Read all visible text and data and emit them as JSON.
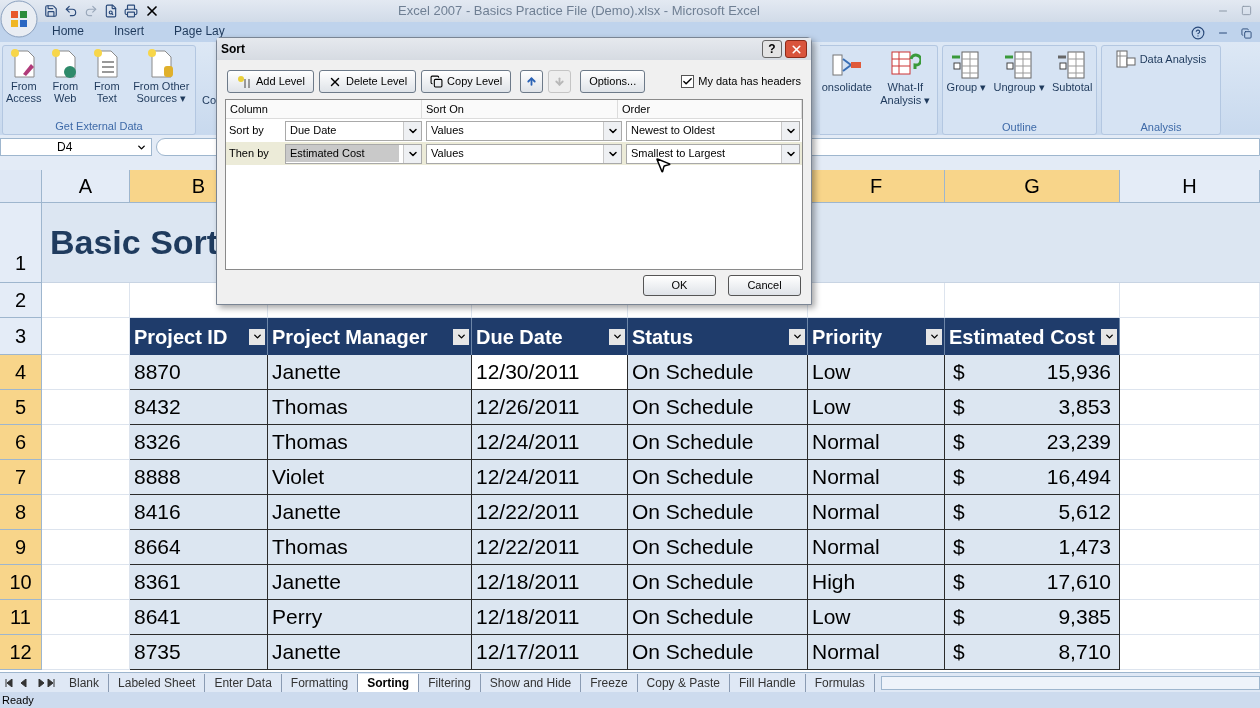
{
  "title_bar": {
    "title": "Excel 2007 - Basics Practice File (Demo).xlsx - Microsoft Excel"
  },
  "ribbon_tabs": [
    {
      "label": "Home"
    },
    {
      "label": "Insert"
    },
    {
      "label": "Page Lay"
    }
  ],
  "ribbon_left": {
    "group_label": "Get External Data",
    "buttons": [
      {
        "kind": "access",
        "label": "From Access"
      },
      {
        "kind": "web",
        "label": "From Web"
      },
      {
        "kind": "text",
        "label": "From Text"
      },
      {
        "kind": "other",
        "label": "From Other Sources ▾"
      }
    ],
    "cut_label": "Co"
  },
  "ribbon_right": [
    {
      "buttons": [
        {
          "kind": "consolidate",
          "label": "onsolidate"
        },
        {
          "kind": "whatif",
          "label": "What-If Analysis ▾"
        }
      ]
    },
    {
      "label": "Outline",
      "buttons": [
        {
          "kind": "group",
          "label": "Group ▾"
        },
        {
          "kind": "ungroup",
          "label": "Ungroup ▾"
        },
        {
          "kind": "subtotal",
          "label": "Subtotal"
        }
      ]
    },
    {
      "label": "Analysis",
      "buttons": [
        {
          "kind": "analysis",
          "label": "Data Analysis"
        }
      ]
    }
  ],
  "formula_bar": {
    "name_box": "D4"
  },
  "sheet": {
    "columns": [
      {
        "label": "A",
        "selected": false
      },
      {
        "label": "B",
        "selected": true
      },
      {
        "label": "F",
        "selected": true
      },
      {
        "label": "G",
        "selected": true
      },
      {
        "label": "H",
        "selected": false
      }
    ],
    "title_row": {
      "number": "1",
      "selected": false,
      "text": "Basic Sort"
    },
    "blank_row": {
      "number": "2",
      "selected": false
    },
    "header_row": {
      "number": "3",
      "selected": false,
      "headers": [
        "Project ID",
        "Project Manager",
        "Due Date",
        "Status",
        "Priority",
        "Estimated Cost"
      ]
    },
    "rows": [
      {
        "number": "4",
        "selected": true,
        "cells": [
          "8870",
          "Janette",
          "12/30/2011",
          "On Schedule",
          "Low"
        ],
        "currency": "$",
        "amount": "15,936"
      },
      {
        "number": "5",
        "selected": true,
        "cells": [
          "8432",
          "Thomas",
          "12/26/2011",
          "On Schedule",
          "Low"
        ],
        "currency": "$",
        "amount": "3,853"
      },
      {
        "number": "6",
        "selected": true,
        "cells": [
          "8326",
          "Thomas",
          "12/24/2011",
          "On Schedule",
          "Normal"
        ],
        "currency": "$",
        "amount": "23,239"
      },
      {
        "number": "7",
        "selected": true,
        "cells": [
          "8888",
          "Violet",
          "12/24/2011",
          "On Schedule",
          "Normal"
        ],
        "currency": "$",
        "amount": "16,494"
      },
      {
        "number": "8",
        "selected": true,
        "cells": [
          "8416",
          "Janette",
          "12/22/2011",
          "On Schedule",
          "Normal"
        ],
        "currency": "$",
        "amount": "5,612"
      },
      {
        "number": "9",
        "selected": true,
        "cells": [
          "8664",
          "Thomas",
          "12/22/2011",
          "On Schedule",
          "Normal"
        ],
        "currency": "$",
        "amount": "1,473"
      },
      {
        "number": "10",
        "selected": true,
        "cells": [
          "8361",
          "Janette",
          "12/18/2011",
          "On Schedule",
          "High"
        ],
        "currency": "$",
        "amount": "17,610"
      },
      {
        "number": "11",
        "selected": true,
        "cells": [
          "8641",
          "Perry",
          "12/18/2011",
          "On Schedule",
          "Low"
        ],
        "currency": "$",
        "amount": "9,385"
      },
      {
        "number": "12",
        "selected": true,
        "cells": [
          "8735",
          "Janette",
          "12/17/2011",
          "On Schedule",
          "Normal"
        ],
        "currency": "$",
        "amount": "8,710"
      }
    ]
  },
  "sheet_tabs": [
    {
      "label": "Blank",
      "selected": false
    },
    {
      "label": "Labeled Sheet",
      "selected": false
    },
    {
      "label": "Enter Data",
      "selected": false
    },
    {
      "label": "Formatting",
      "selected": false
    },
    {
      "label": "Sorting",
      "selected": true
    },
    {
      "label": "Filtering",
      "selected": false
    },
    {
      "label": "Show and Hide",
      "selected": false
    },
    {
      "label": "Freeze",
      "selected": false
    },
    {
      "label": "Copy & Paste",
      "selected": false
    },
    {
      "label": "Fill Handle",
      "selected": false
    },
    {
      "label": "Formulas",
      "selected": false
    }
  ],
  "status_bar": {
    "text": "Ready"
  },
  "dialog": {
    "title": "Sort",
    "help": "?",
    "buttons": [
      {
        "kind": "add",
        "label": "Add Level"
      },
      {
        "kind": "delete",
        "label": "Delete Level"
      },
      {
        "kind": "copy",
        "label": "Copy Level"
      }
    ],
    "move_up": {
      "disabled": false
    },
    "move_down": {
      "disabled": true
    },
    "options": "Options...",
    "headers_checkbox": {
      "label": "My data has headers",
      "checked": true
    },
    "columns": [
      "Column",
      "Sort On",
      "Order"
    ],
    "levels": [
      {
        "label": "Sort by",
        "column": "Due Date",
        "sort_on": "Values",
        "order": "Newest to Oldest",
        "selected": false
      },
      {
        "label": "Then by",
        "column": "Estimated Cost",
        "sort_on": "Values",
        "order": "Smallest to Largest",
        "selected": true
      }
    ],
    "ok": "OK",
    "cancel": "Cancel"
  }
}
